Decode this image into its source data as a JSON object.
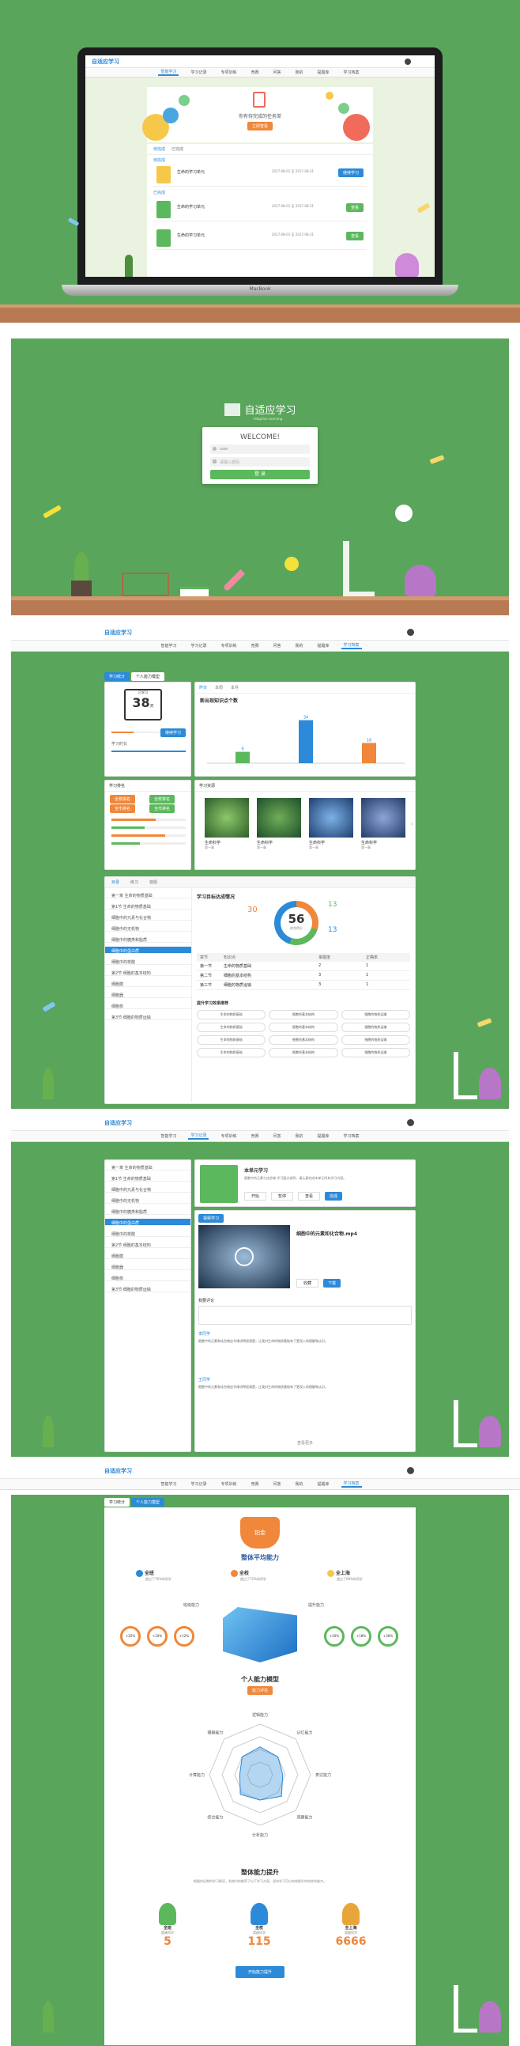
{
  "laptop": {
    "brand": "MacBook",
    "app_logo": "自适应学习",
    "nav": [
      "智能学习",
      "学习记录",
      "专项训练",
      "竞赛",
      "问答",
      "我的",
      "提醒库",
      "学习档案"
    ],
    "hero_text": "你有待完成的任务单",
    "hero_btn": "立即查看",
    "tabs": [
      "待完成",
      "已完成"
    ],
    "section1": "待完成",
    "section2": "已完成",
    "tasks": [
      {
        "title": "生命的学习单元",
        "meta": "2017-08-01 至 2017-08-31",
        "btn": "继续学习",
        "color": "#2c8ad8"
      },
      {
        "title": "生命的学习单元",
        "meta": "2017-08-01 至 2017-08-31",
        "btn": "查看",
        "color": "#5cb85c"
      },
      {
        "title": "生命的学习单元",
        "meta": "2017-08-01 至 2017-08-31",
        "btn": "查看",
        "color": "#5cb85c"
      }
    ]
  },
  "login": {
    "logo": "自适应学习",
    "logo_sub": "Adaptive Learning",
    "welcome": "WELCOME!",
    "user_placeholder": "user",
    "pass_placeholder": "请输入密码",
    "submit": "登 录"
  },
  "dashboard": {
    "logo": "自适应学习",
    "nav": [
      "智能学习",
      "学习记录",
      "专项训练",
      "竞赛",
      "问答",
      "我的",
      "提醒库",
      "学习档案"
    ],
    "left_tabs": [
      "学习统计",
      "个人能力模型"
    ],
    "calendar_top": "已学习",
    "days": "38",
    "days_unit": "天",
    "study_time_label": "学习时长",
    "study_btn": "继续学习",
    "stats_tabs": [
      "昨天",
      "本周",
      "本月"
    ],
    "chart_title": "新出现知识点个数",
    "chart_data": {
      "type": "bar",
      "categories": [
        "A",
        "B",
        "C"
      ],
      "values": [
        9,
        34,
        16
      ],
      "ylim": [
        0,
        40
      ]
    },
    "rank_title": "学习排名",
    "rank_pills": [
      "全校排名",
      "全校排名",
      "全市排名",
      "全市排名"
    ],
    "course_title": "学习资源",
    "courses": [
      {
        "name": "生命科学",
        "sub": "第一章"
      },
      {
        "name": "生命科学",
        "sub": "第一章"
      },
      {
        "name": "生命科学",
        "sub": "第一章"
      },
      {
        "name": "生命科学",
        "sub": "第一章"
      }
    ],
    "tree_tabs": [
      "目录",
      "练习",
      "错题"
    ],
    "tree_items": [
      "第一章 生命的物质基础",
      "第1节 生命的物质基础",
      "细胞中的元素与化合物",
      "细胞中的无机物",
      "细胞中的糖类和脂质",
      "细胞中的蛋白质",
      "细胞中的核酸",
      "第2节 细胞的基本结构",
      "细胞膜",
      "细胞器",
      "细胞核",
      "第3节 细胞的物质运输"
    ],
    "progress_title": "学习目标达成情况",
    "score": "56",
    "score_label": "综合得分",
    "left_num": "30",
    "right_num1": "13",
    "right_num2": "13",
    "table_head": [
      "章节",
      "知识点",
      "掌握度",
      "正确率"
    ],
    "table_rows": [
      [
        "第一节",
        "生命的物质基础",
        "2",
        "1"
      ],
      [
        "第二节",
        "细胞的基本结构",
        "3",
        "1"
      ],
      [
        "第三节",
        "细胞的物质运输",
        "3",
        "1"
      ]
    ],
    "recommend_title": "提升学习效果推荐",
    "recommend": [
      "生命的物质基础",
      "细胞的基本结构",
      "细胞的物质运输",
      "生命的物质基础",
      "细胞的基本结构",
      "细胞的物质运输",
      "生命的物质基础",
      "细胞的基本结构",
      "细胞的物质运输",
      "生命的物质基础",
      "细胞的基本结构",
      "细胞的物质运输"
    ]
  },
  "video": {
    "nav_active": "学习记录",
    "task_title": "本单元学习",
    "task_desc": "细胞中的元素与化合物 学习要点说明，请认真完成本单元所有学习内容。",
    "task_btns": [
      "开始",
      "暂停",
      "查看",
      "完成"
    ],
    "video_tab": "视频学习",
    "video_title": "细胞中的元素和化合物.mp4",
    "video_btns": [
      "收藏",
      "下载"
    ],
    "comment_label": "我要评论",
    "comments": [
      {
        "name": "李同学",
        "text": "细胞中的元素和化合物这节课讲得很清楚，让我对生命的物质基础有了更深入的理解和认识。"
      },
      {
        "name": "王同学",
        "text": "细胞中的元素和化合物这节课讲得很清楚，让我对生命的物质基础有了更深入的理解和认识。"
      }
    ],
    "more": "查看更多"
  },
  "ability": {
    "tabs": [
      "学习统计",
      "个人能力模型"
    ],
    "badge": "铂金",
    "title1": "整体平均能力",
    "ranks": [
      {
        "name": "全班",
        "desc": "超过了76%的同学"
      },
      {
        "name": "全校",
        "desc": "超过了72%的同学"
      },
      {
        "name": "全上海",
        "desc": "超过了68%的同学"
      }
    ],
    "cube_left": "班级能力",
    "cube_right": "提升能力",
    "circles": [
      "+25%",
      "+10%",
      "+12%",
      "+20%",
      "+18%",
      "+30%"
    ],
    "title2": "个人能力模型",
    "model_btn": "能力评估",
    "radar_labels": [
      "逻辑能力",
      "记忆能力",
      "表达能力",
      "观察能力",
      "分析能力",
      "综合能力",
      "计算能力",
      "理解能力"
    ],
    "title3": "整体能力提升",
    "desc3": "根据你近期的学习情况，系统为你推荐了以下学习方案，坚持学习可以有效提升你的综合能力。",
    "medals": [
      {
        "name": "全班",
        "sub": "超越同学",
        "num": "5"
      },
      {
        "name": "全校",
        "sub": "超越同学",
        "num": "115"
      },
      {
        "name": "全上海",
        "sub": "超越同学",
        "num": "6666"
      }
    ],
    "bottom_btn": "开始能力提升"
  }
}
